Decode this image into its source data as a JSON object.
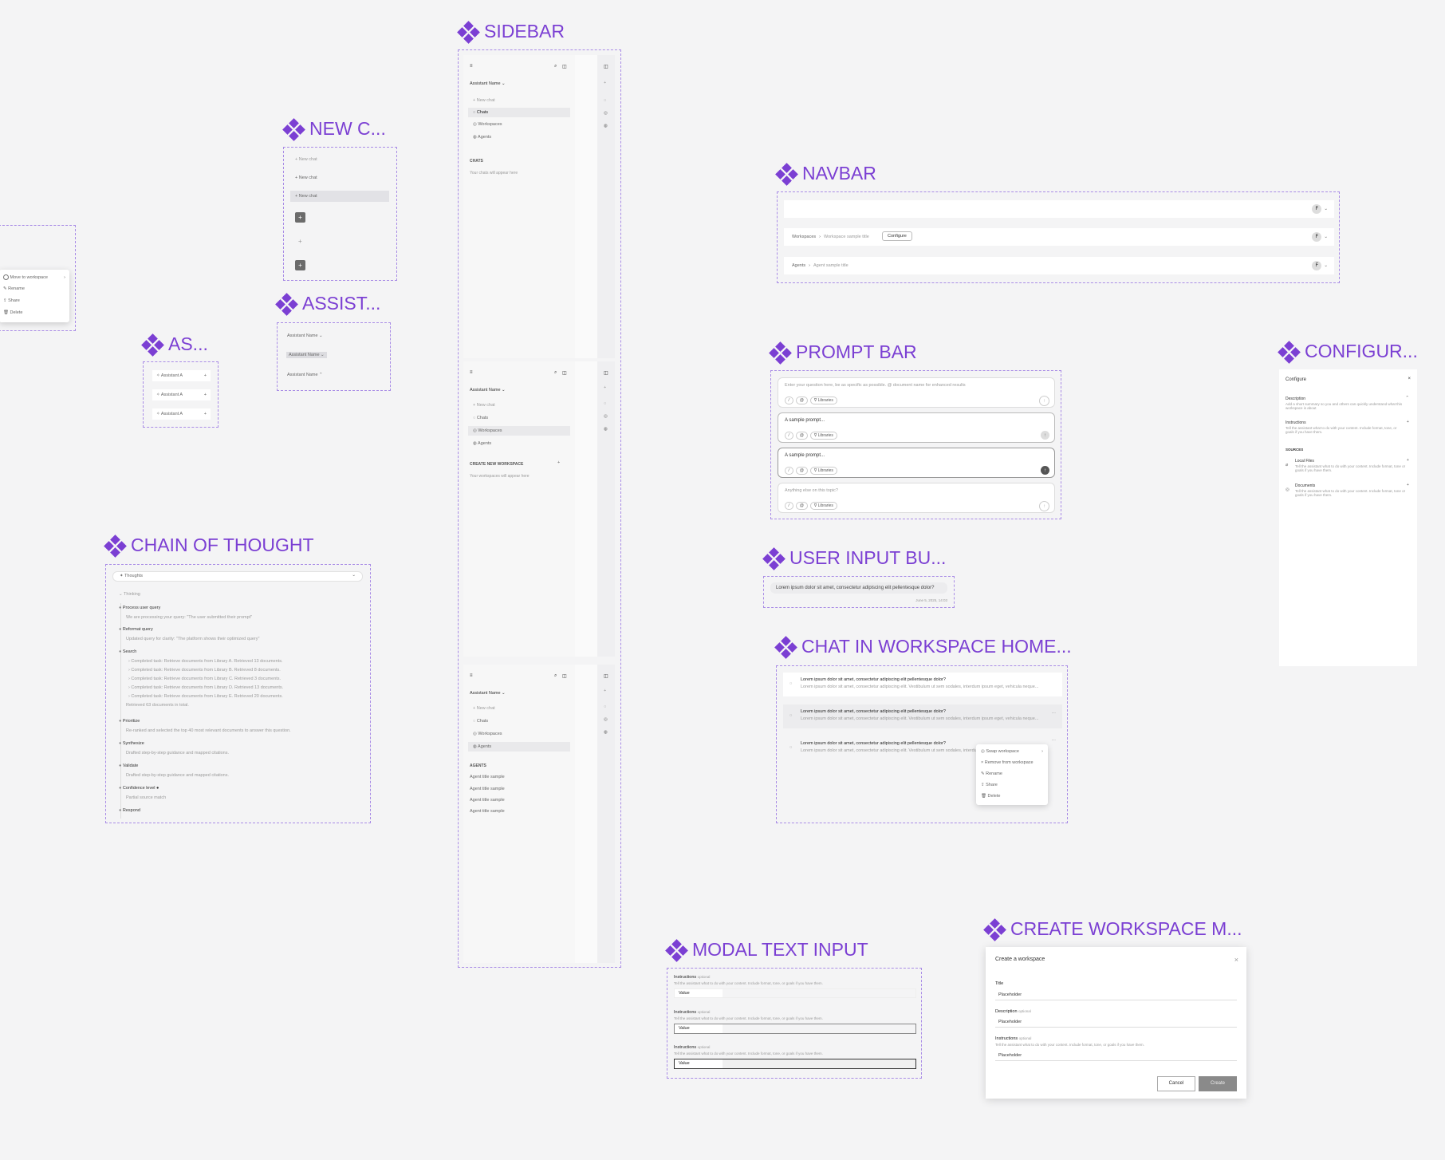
{
  "sections": {
    "sidebar": "SIDEBAR",
    "new_chat": "NEW C...",
    "assistant": "ASSIST...",
    "as": "AS...",
    "navbar": "NAVBAR",
    "prompt_bar": "PROMPT BAR",
    "configure": "CONFIGUR...",
    "chain_of_thought": "CHAIN OF THOUGHT",
    "user_input": "USER INPUT BU...",
    "chat_in_workspace": "CHAT IN WORKSPACE HOME...",
    "modal_text_input": "MODAL TEXT INPUT",
    "create_workspace": "CREATE WORKSPACE M..."
  },
  "context_menu": {
    "items": [
      "Move to workspace",
      "Rename",
      "Share",
      "Delete"
    ]
  },
  "new_chat": {
    "items": [
      "New chat",
      "New chat",
      "New chat"
    ],
    "plus": "+"
  },
  "assistant_dropdowns": [
    "Assistant Name",
    "Assistant Name",
    "Assistant Name"
  ],
  "as_items": {
    "label": "Assistant A",
    "count": 3
  },
  "sidebar": {
    "assistant_name": "Assistant Name",
    "new_chat": "New chat",
    "nav": [
      "Chats",
      "Workspaces",
      "Agents"
    ],
    "panels": [
      {
        "active": 0,
        "section": "CHATS",
        "empty": "Your chats will appear here"
      },
      {
        "active": 1,
        "section": "CREATE NEW WORKSPACE",
        "empty": "Your workspaces will appear here"
      },
      {
        "active": 2,
        "section": "AGENTS",
        "items": [
          "Agent title sample",
          "Agent title sample",
          "Agent title sample",
          "Agent title sample"
        ]
      }
    ]
  },
  "navbar": {
    "avatar": "F",
    "rows": [
      {
        "crumbs": []
      },
      {
        "crumbs": [
          "Workspaces",
          "Workspace sample title"
        ],
        "button": "Configure"
      },
      {
        "crumbs": [
          "Agents",
          "Agent sample title"
        ]
      }
    ]
  },
  "prompt_bar": {
    "libraries": "Libraries",
    "inputs": [
      "Enter your question here, be as specific as possible. @ document name for enhanced results",
      "A sample prompt...",
      "A sample prompt...",
      "Anything else on this topic?"
    ]
  },
  "configure": {
    "title": "Configure",
    "description_label": "Description",
    "description_help": "Add a short summary so you and others can quickly understand what this workspace is about",
    "instructions_label": "Instructions",
    "instructions_help": "Tell the assistant what to do with your content. Include format, tone, or goals if you have them.",
    "sources_label": "SOURCES",
    "local_files": "Local Files",
    "local_files_help": "Tell the assistant what to do with your content. Include format, tone or goals if you have them.",
    "documents": "Documents",
    "documents_help": "Tell the assistant what to do with your content. Include format, tone or goals if you have them."
  },
  "chain_of_thought": {
    "header": "Thoughts",
    "thinking": "Thinking",
    "steps": [
      {
        "title": "Process user query",
        "details": [
          "We are processing your query: \"The user submitted their prompt\""
        ]
      },
      {
        "title": "Reformat query",
        "details": [
          "Updated query for clarity: \"The platform shows their optimized query\""
        ]
      },
      {
        "title": "Search",
        "details": [
          "Completed task: Retrieve documents from Library A. Retrieved 13 documents.",
          "Completed task: Retrieve documents from Library B. Retrieved 8 documents.",
          "Completed task: Retrieve documents from Library C. Retrieved 3 documents.",
          "Completed task: Retrieve documents from Library D. Retrieved 13 documents.",
          "Completed task: Retrieve documents from Library E. Retrieved 20 documents.",
          "Retrieved 63 documents in total."
        ]
      },
      {
        "title": "Prioritize",
        "details": [
          "Re-ranked and selected the top 40 most relevant documents to answer this question."
        ]
      },
      {
        "title": "Synthesize",
        "details": [
          "Drafted step-by-step guidance and mapped citations."
        ]
      },
      {
        "title": "Validate",
        "details": [
          "Drafted step-by-step guidance and mapped citations."
        ]
      },
      {
        "title": "Confidence level ●",
        "details": [
          "Partial source match"
        ]
      },
      {
        "title": "Respond",
        "details": []
      }
    ]
  },
  "user_input": {
    "text": "Lorem ipsum dolor sit amet, consectetur adipiscing elit pellentesque dolor?",
    "date": "June 5, 2025, 14:03"
  },
  "chat_workspace": {
    "title": "Lorem ipsum dolor sit amet, consectetur adipiscing elit pellentesque dolor?",
    "preview": "Lorem ipsum dolor sit amet, consectetur adipiscing elit. Vestibulum ut sem sodales, interdum ipsum eget, vehicula neque...",
    "menu": [
      "Swap workspace",
      "Remove from workspace",
      "Rename",
      "Share",
      "Delete"
    ]
  },
  "modal_text_input": {
    "label": "Instructions",
    "optional": "optional",
    "help": "Tell the assistant what to do with your content. Include format, tone, or goals if you have them.",
    "value": "Value"
  },
  "create_workspace": {
    "title": "Create a workspace",
    "title_label": "Title",
    "description_label": "Description",
    "instructions_label": "Instructions",
    "optional": "optional",
    "instructions_help": "Tell the assistant what to do with your content. Include format, tone, or goals if you have them.",
    "placeholder": "Placeholder",
    "cancel": "Cancel",
    "create": "Create"
  }
}
